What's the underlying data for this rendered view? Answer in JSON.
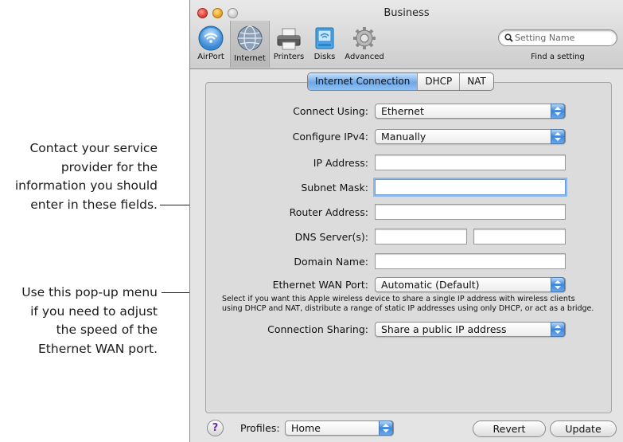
{
  "callouts": {
    "fields_note": [
      "Contact your service",
      "provider for the",
      "information you should",
      "enter in these fields."
    ],
    "wan_note": [
      "Use this pop-up menu",
      "if you need to adjust",
      "the speed of the",
      "Ethernet WAN port."
    ]
  },
  "window": {
    "title": "Business",
    "toolbar": [
      {
        "label": "AirPort",
        "icon": "airport-icon"
      },
      {
        "label": "Internet",
        "icon": "internet-globe-icon",
        "active": true
      },
      {
        "label": "Printers",
        "icon": "printer-icon"
      },
      {
        "label": "Disks",
        "icon": "disk-icon"
      },
      {
        "label": "Advanced",
        "icon": "gear-icon"
      }
    ],
    "search": {
      "placeholder": "Setting Name",
      "caption": "Find a setting"
    }
  },
  "tabs": [
    {
      "label": "Internet Connection",
      "active": true
    },
    {
      "label": "DHCP"
    },
    {
      "label": "NAT"
    }
  ],
  "form": {
    "connect_using": {
      "label": "Connect Using:",
      "value": "Ethernet"
    },
    "configure_ipv4": {
      "label": "Configure IPv4:",
      "value": "Manually"
    },
    "ip_address": {
      "label": "IP Address:",
      "value": ""
    },
    "subnet_mask": {
      "label": "Subnet Mask:",
      "value": ""
    },
    "router_address": {
      "label": "Router Address:",
      "value": ""
    },
    "dns_servers": {
      "label": "DNS Server(s):",
      "value1": "",
      "value2": ""
    },
    "domain_name": {
      "label": "Domain Name:",
      "value": ""
    },
    "ethernet_wan_port": {
      "label": "Ethernet WAN Port:",
      "value": "Automatic (Default)"
    },
    "help_text": "Select if you want this Apple wireless device to share a single IP address with wireless clients using DHCP and NAT, distribute a range of static IP addresses using only DHCP, or act as a bridge.",
    "connection_sharing": {
      "label": "Connection Sharing:",
      "value": "Share a public IP address"
    }
  },
  "bottom": {
    "help": "?",
    "profiles_label": "Profiles:",
    "profiles_value": "Home",
    "revert": "Revert",
    "update": "Update"
  },
  "colors": {
    "accent_blue": "#3d87dc",
    "window_bg": "#e4e4e4"
  }
}
